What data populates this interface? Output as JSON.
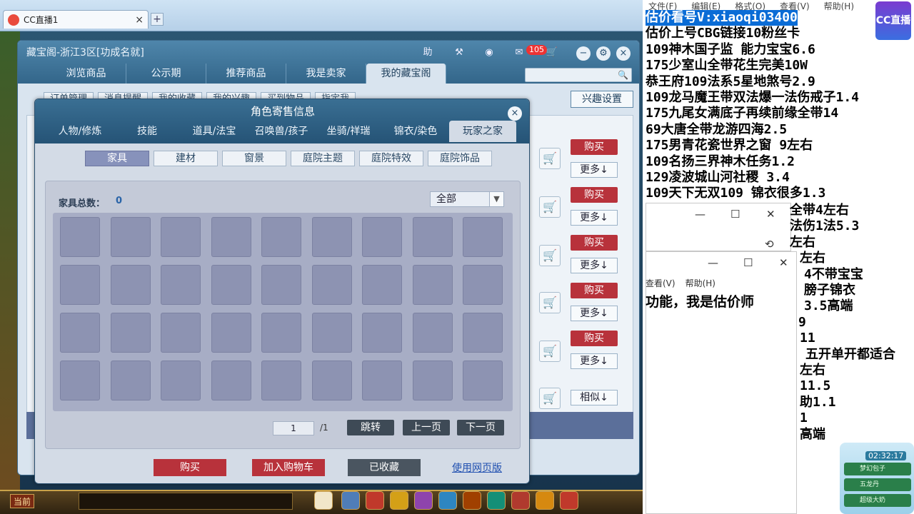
{
  "browser": {
    "tab_title": "CC直播1",
    "close_glyph": "×",
    "newtab_glyph": "+"
  },
  "game": {
    "current_channel": "当前"
  },
  "main_window": {
    "title": "藏宝阁-浙江3区[功成名就]",
    "help": "助",
    "cart_badge": "105",
    "nav_tabs": [
      "浏览商品",
      "公示期",
      "推荐商品",
      "我是卖家",
      "我的藏宝阁"
    ],
    "active_nav": 4,
    "sub_buttons": [
      "订单管理",
      "消息提醒",
      "我的收藏",
      "我的兴趣",
      "买到物品",
      "指定我"
    ],
    "interest_settings": "兴趣设置",
    "row_buy": "购买",
    "row_more": "更多↓",
    "row_similar": "相似↓"
  },
  "dialog": {
    "title": "角色寄售信息",
    "tabs": [
      "人物/修炼",
      "技能",
      "道具/法宝",
      "召唤兽/孩子",
      "坐骑/祥瑞",
      "锦衣/染色",
      "玩家之家"
    ],
    "active_tab": 6,
    "categories": [
      "家具",
      "建材",
      "窗景",
      "庭院主题",
      "庭院特效",
      "庭院饰品"
    ],
    "active_category": 0,
    "count_label": "家具总数：",
    "count_value": "0",
    "filter_value": "全部",
    "grid_rows": 4,
    "grid_cols": 9,
    "page_current": "1",
    "page_total": "/1",
    "jump": "跳转",
    "prev": "上一页",
    "next": "下一页",
    "buy": "购买",
    "add_cart": "加入购物车",
    "favorited": "已收藏",
    "web_version": "使用网页版"
  },
  "notepad": {
    "menu": [
      "文件(F)",
      "编辑(E)",
      "格式(O)",
      "查看(V)",
      "帮助(H)"
    ],
    "lines": [
      "估价看号V:xiaoqi03400",
      "估价上号CBG链接10粉丝卡",
      "109神木国子监 能力宝宝6.6",
      "175少室山全带花生完美10W",
      "恭王府109法系5星地煞号2.9",
      "109龙马魔王带双法爆一法伤戒子1.4",
      "175九尾女满底子再续前缘全带14",
      "69大唐全带龙游四海2.5",
      "175男青花瓷世界之窗  9左右",
      "109名扬三界神木任务1.2",
      "129凌波城山河社稷  3.4",
      "109天下无双109  锦衣很多1.3"
    ],
    "partial_lines": [
      "全带4左右",
      "法伤1法5.3",
      "左右",
      "左右",
      "4不带宝宝",
      "膀子锦衣",
      "3.5高端",
      "9",
      "11",
      "五开单开都适合",
      "左右",
      "11.5",
      "助1.1",
      "1",
      "高端"
    ],
    "popup2_menu": [
      "查看(V)",
      "帮助(H)"
    ],
    "popup2_text": "功能，我是估价师",
    "cc_badge": "CC直播"
  },
  "widget": {
    "time": "02:32:17",
    "items": [
      "梦幻包子",
      "五龙丹",
      "超级大奶"
    ]
  }
}
